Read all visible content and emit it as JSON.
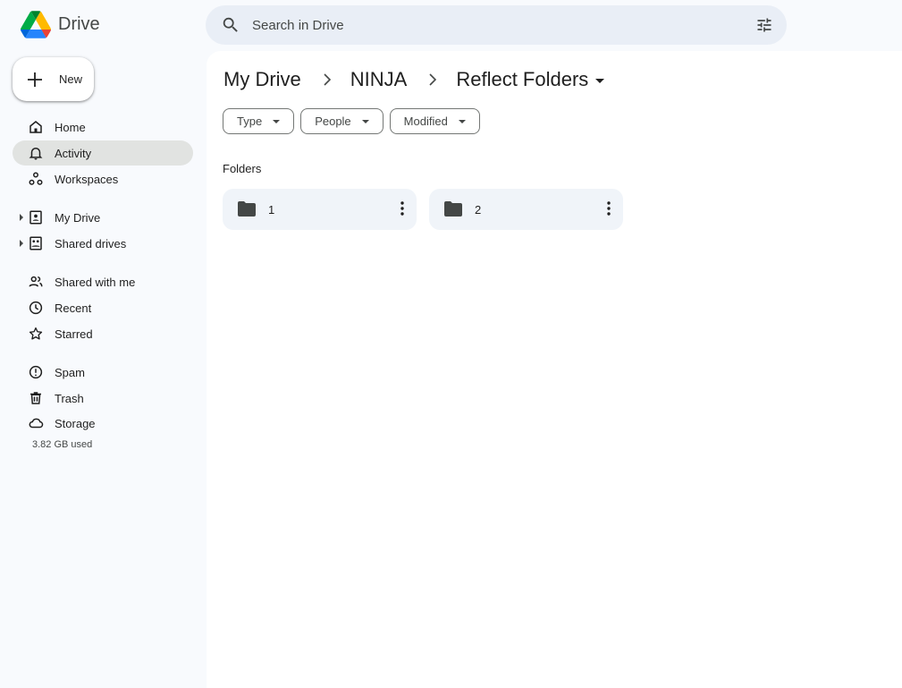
{
  "app": {
    "name": "Drive"
  },
  "search": {
    "placeholder": "Search in Drive"
  },
  "new_button": {
    "label": "New"
  },
  "sidebar": {
    "items": [
      {
        "label": "Home",
        "icon": "home-icon"
      },
      {
        "label": "Activity",
        "icon": "bell-icon",
        "active": true
      },
      {
        "label": "Workspaces",
        "icon": "workspaces-icon"
      },
      {
        "label": "My Drive",
        "icon": "my-drive-icon",
        "expandable": true
      },
      {
        "label": "Shared drives",
        "icon": "shared-drives-icon",
        "expandable": true
      },
      {
        "label": "Shared with me",
        "icon": "people-icon"
      },
      {
        "label": "Recent",
        "icon": "clock-icon"
      },
      {
        "label": "Starred",
        "icon": "star-icon"
      },
      {
        "label": "Spam",
        "icon": "spam-icon"
      },
      {
        "label": "Trash",
        "icon": "trash-icon"
      },
      {
        "label": "Storage",
        "icon": "cloud-icon"
      }
    ],
    "storage_used": "3.82 GB used"
  },
  "breadcrumb": {
    "items": [
      "My Drive",
      "NINJA",
      "Reflect Folders"
    ]
  },
  "filters": {
    "chips": [
      "Type",
      "People",
      "Modified"
    ]
  },
  "main": {
    "section_title": "Folders",
    "folders": [
      {
        "name": "1"
      },
      {
        "name": "2"
      }
    ]
  },
  "colors": {
    "background": "#f8fafd",
    "search_bg": "#e9eef6",
    "active_nav_bg": "#e1e3e1",
    "folder_card_bg": "#f0f4f9"
  }
}
